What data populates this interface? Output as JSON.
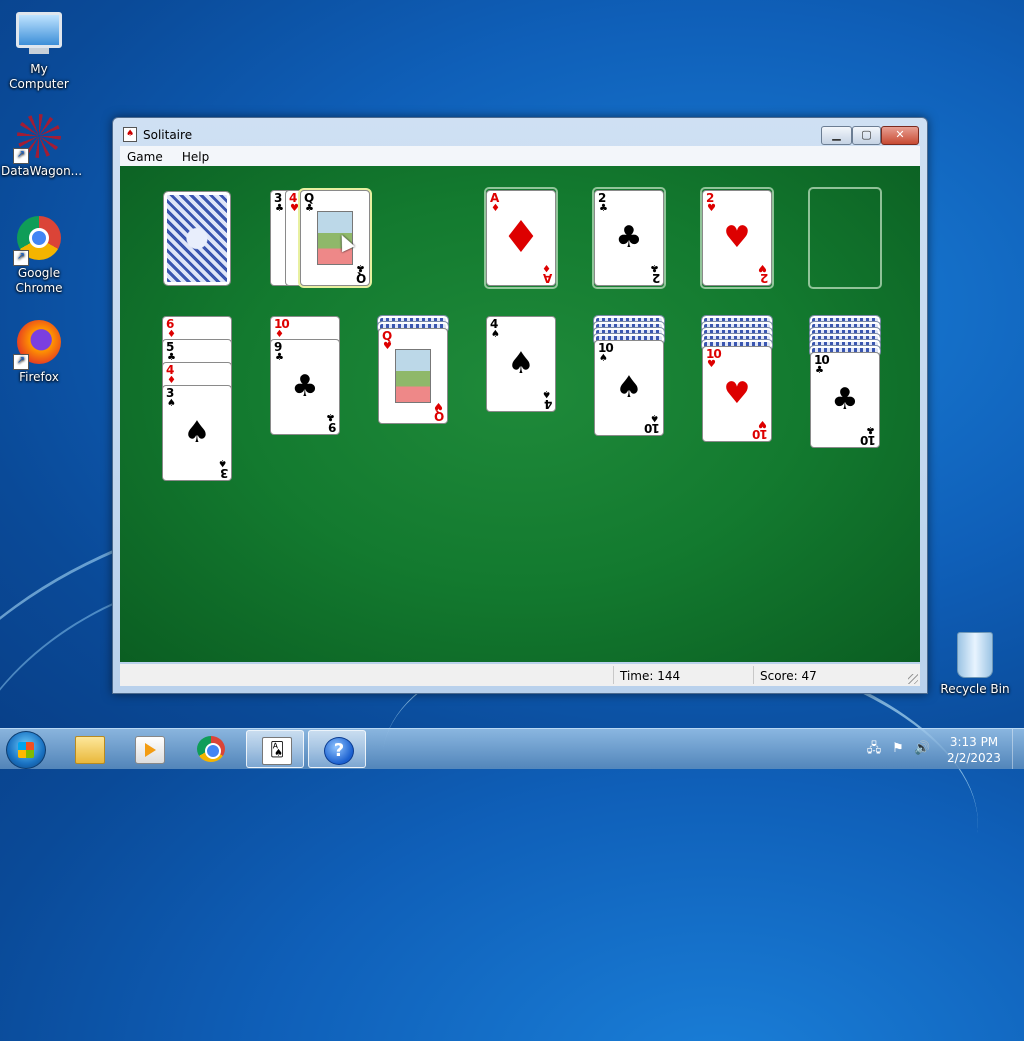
{
  "desktop": {
    "icons": [
      {
        "label": "My Computer",
        "icon": "computer-icon"
      },
      {
        "label": "DataWagon...",
        "icon": "datawagon-icon"
      },
      {
        "label": "Google Chrome",
        "icon": "chrome-icon"
      },
      {
        "label": "Firefox",
        "icon": "firefox-icon"
      },
      {
        "label": "Recycle Bin",
        "icon": "recycle-bin-icon"
      }
    ]
  },
  "window": {
    "title": "Solitaire",
    "menu": [
      "Game",
      "Help"
    ],
    "status": {
      "time_label": "Time:",
      "time_value": "144",
      "score_label": "Score:",
      "score_value": "47"
    }
  },
  "game": {
    "stock": {
      "face_down": true
    },
    "waste": [
      {
        "rank": "3",
        "suit": "♣",
        "color": "black"
      },
      {
        "rank": "4",
        "suit": "♥",
        "color": "red"
      },
      {
        "rank": "Q",
        "suit": "♣",
        "color": "black",
        "face_card": true
      }
    ],
    "foundations": [
      {
        "rank": "A",
        "suit": "♦",
        "color": "red"
      },
      {
        "rank": "2",
        "suit": "♣",
        "color": "black"
      },
      {
        "rank": "2",
        "suit": "♥",
        "color": "red"
      },
      {
        "rank": "",
        "suit": "",
        "empty": true
      }
    ],
    "tableau": [
      {
        "hidden": 0,
        "cards": [
          {
            "rank": "6",
            "suit": "♦",
            "color": "red"
          },
          {
            "rank": "5",
            "suit": "♣",
            "color": "black"
          },
          {
            "rank": "4",
            "suit": "♦",
            "color": "red"
          },
          {
            "rank": "3",
            "suit": "♠",
            "color": "black"
          }
        ]
      },
      {
        "hidden": 0,
        "cards": [
          {
            "rank": "10",
            "suit": "♦",
            "color": "red"
          },
          {
            "rank": "9",
            "suit": "♣",
            "color": "black"
          }
        ]
      },
      {
        "hidden": 2,
        "cards": [
          {
            "rank": "Q",
            "suit": "♥",
            "color": "red",
            "face_card": true
          }
        ]
      },
      {
        "hidden": 0,
        "cards": [
          {
            "rank": "4",
            "suit": "♠",
            "color": "black"
          }
        ]
      },
      {
        "hidden": 4,
        "cards": [
          {
            "rank": "10",
            "suit": "♠",
            "color": "black"
          }
        ]
      },
      {
        "hidden": 5,
        "cards": [
          {
            "rank": "10",
            "suit": "♥",
            "color": "red"
          }
        ]
      },
      {
        "hidden": 6,
        "cards": [
          {
            "rank": "10",
            "suit": "♣",
            "color": "black"
          }
        ]
      }
    ]
  },
  "taskbar": {
    "start_icon": "windows-start-icon",
    "pinned": [
      "explorer-icon",
      "media-player-icon",
      "chrome-icon",
      "solitaire-icon",
      "help-icon"
    ],
    "active": "solitaire-icon",
    "tray": [
      "network-icon",
      "action-center-icon",
      "volume-icon"
    ],
    "clock_time": "3:13 PM",
    "clock_date": "2/2/2023"
  }
}
